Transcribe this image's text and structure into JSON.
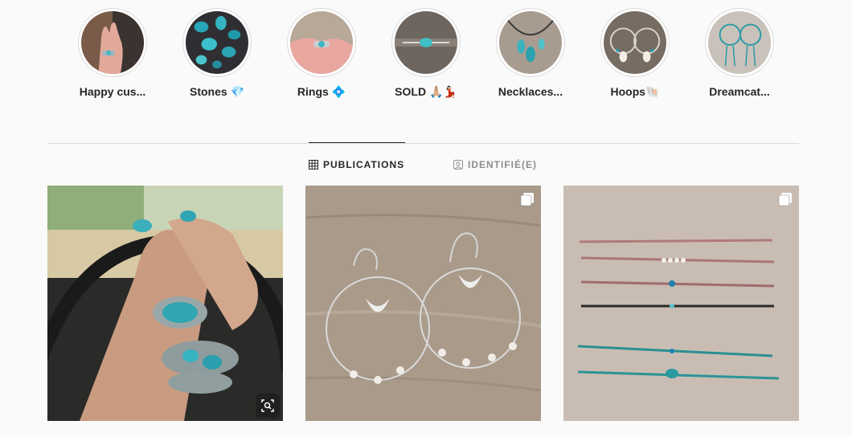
{
  "highlights": [
    {
      "label": "Happy cus..."
    },
    {
      "label": "Stones 💎"
    },
    {
      "label": "Rings 💠"
    },
    {
      "label": "SOLD 🙏🏼💃🏻"
    },
    {
      "label": "Necklaces..."
    },
    {
      "label": "Hoops🐚"
    },
    {
      "label": "Dreamcat..."
    }
  ],
  "tabs": {
    "posts_label": "PUBLICATIONS",
    "tagged_label": "IDENTIFIÉ(E)"
  },
  "colors": {
    "text": "#262626",
    "muted": "#8e8e8e",
    "divider": "#dbdbdb",
    "background": "#fafafa"
  }
}
